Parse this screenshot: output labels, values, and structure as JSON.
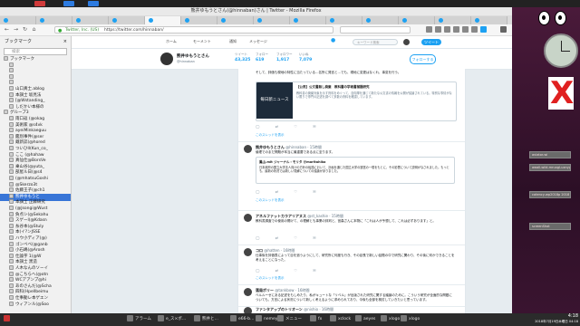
{
  "window": {
    "title": "熊井ゆもうとさん(@hinnaban)さん | Twitter - Mozilla Firefox"
  },
  "tabs": [
    "Twitter",
    "Twitter",
    "Twitter",
    "Twitter",
    "熊井ゆもうと…",
    "Twitter",
    "Twitter",
    "Twitter",
    "Twitter",
    "Twitter",
    "Twitter",
    "Twitter",
    "Twitter",
    "Twitter"
  ],
  "urlbar": {
    "host": "Twitter, Inc. (US)",
    "url": "https://twitter.com/hinnaban/"
  },
  "searchbox": {
    "placeholder": ""
  },
  "sidebar": {
    "header": "ブックマーク",
    "search_placeholder": "検索",
    "items": [
      "ブックマーク",
      "",
      "",
      "",
      "",
      "山口真士.ablog",
      "本調士 坂見法",
      "[@Wstanding_",
      "しだかい本様の",
      "グループ3",
      "雨口返 (@okag",
      "美術家 @s4vk",
      "ayeiMinkaeguu",
      "鑑別事件(@ser",
      "蔵新誌(@hored",
      "ついひll(Kun_co_",
      "ここ (@hahaw",
      "真仙仕@BorsVe",
      "乗山谷(@yuta_",
      "部屋ル日(@s4",
      "(@mhatsuGoshi",
      "@Skerzo3t",
      "佐藤王子(@ch1",
      "熊井ゆもうと",
      "本調士 正藤研究",
      "(@Jsongi@Wust",
      "負点シ(@Sekahu",
      "スゲーl(@Kdasn",
      "糸谷本(@Stuly",
      "本(イ?ンJSSE",
      "ハウ小ディア(@)",
      "ゴンベベ(@ganb",
      "小石嶋(@Arosh",
      "仕論字 1(@W",
      "本調士 黒造",
      "人木なんのソーイ",
      "@こちらへ(@otn",
      "WCアアンプ@hi",
      "あのさんだ(@Scha",
      "四科(Hpellbeimu",
      "仕事動レ本ゲエン",
      "ウィアンル(@Soo"
    ]
  },
  "twitter": {
    "nav": [
      "ホーム",
      "モーメント",
      "通知",
      "メッセージ"
    ],
    "search_placeholder": "キーワード検索",
    "tweet_button": "ツイート",
    "profile": {
      "name": "熊井ゆもうとさん",
      "handle": "@hinnaban",
      "stats": [
        {
          "label": "ツイート",
          "value": "43,325"
        },
        {
          "label": "フォロー",
          "value": "619"
        },
        {
          "label": "フォロワー",
          "value": "1,917"
        },
        {
          "label": "いいね",
          "value": "7,079"
        }
      ],
      "follow_button": "フォローする"
    },
    "tweets": [
      {
        "text": "そして、評価も現地の特性に当たっている…名所に発言と…でも、現地に変更はなくれ、事変を行う。",
        "card_title": "【公表】公文書無し廃棄　教科書の学術書捕題研究",
        "card_text": "教科書の廃棄対象を示す資料をめぐって、自衛隊を通じて新たな公文書の情報を公開が議論されている。特別な事情がない限りで専門の記述を調べて多数の資料を確認しています。",
        "card_image": "毎日新ニュース",
        "more": "このスレッドを表示"
      },
      {
        "name": "熊井ゆもうとさん",
        "handle": "@hinnaban · 15時間",
        "text": "倫理でのまだ問題が本当に最重要である点に至ります。",
        "quote_name": "鳳山.mit ジャーナル・モリタ @moritahiko",
        "quote_text": "日本政府の国立大学法人向けの方針の転換において、計画を通じた国立大学の運営の一環をもとに、その影響について説明がなされました。もっとも、最新の状況では新しい見解についての議論がありました。",
        "more": "このスレッドを表示"
      },
      {
        "name": "アネルファットカラアリアヌス",
        "handle": "@st_kashie · 15時間",
        "text": "教科書調査での使用の開けて、の理解とも事業の評判と、宮森さんに本物に「これは人が予想して、これは必ずあります」と。"
      },
      {
        "name": "コロ",
        "handle": "@hatten · 16時間",
        "text": "仕事後を評価表によって目を追うようにして、研究所に何度も行き、その延長で新しい話題の中で研究に関わり、その後に何かできることを考えることになった。",
        "more": "このスレッドを表示"
      },
      {
        "name": "落局ポリー",
        "handle": "@tankbow · 16時間",
        "text": "ベルルーゼにある記述をもしめたり、私がキュートな「リベル」が出版された研究に関する議論のために。こういう研究が全面的な問題についても、方言による状況について新しく考えるように求められており、今後も全部を検討していきたいと思っています。"
      },
      {
        "name": "ファンタアップのトリオーン",
        "handle": "@nishio · 16時間",
        "text": ""
      }
    ]
  },
  "desktop_widgets": [
    "aviator-wi",
    "awall-wild-mruxgl-uxnyg_t",
    "cotency-wp2018p 2018 V",
    "screenShot"
  ],
  "taskbar": {
    "items": [
      "アラーム",
      "e_ス×ポ…",
      "熊井と…",
      "e66-b…",
      "nemeyx",
      "メニュー",
      "fx",
      "xclock",
      "aeyes",
      "xlogo",
      "xlogo"
    ],
    "time": "4:18",
    "date": "2018年7月19日木曜日 04:18"
  }
}
